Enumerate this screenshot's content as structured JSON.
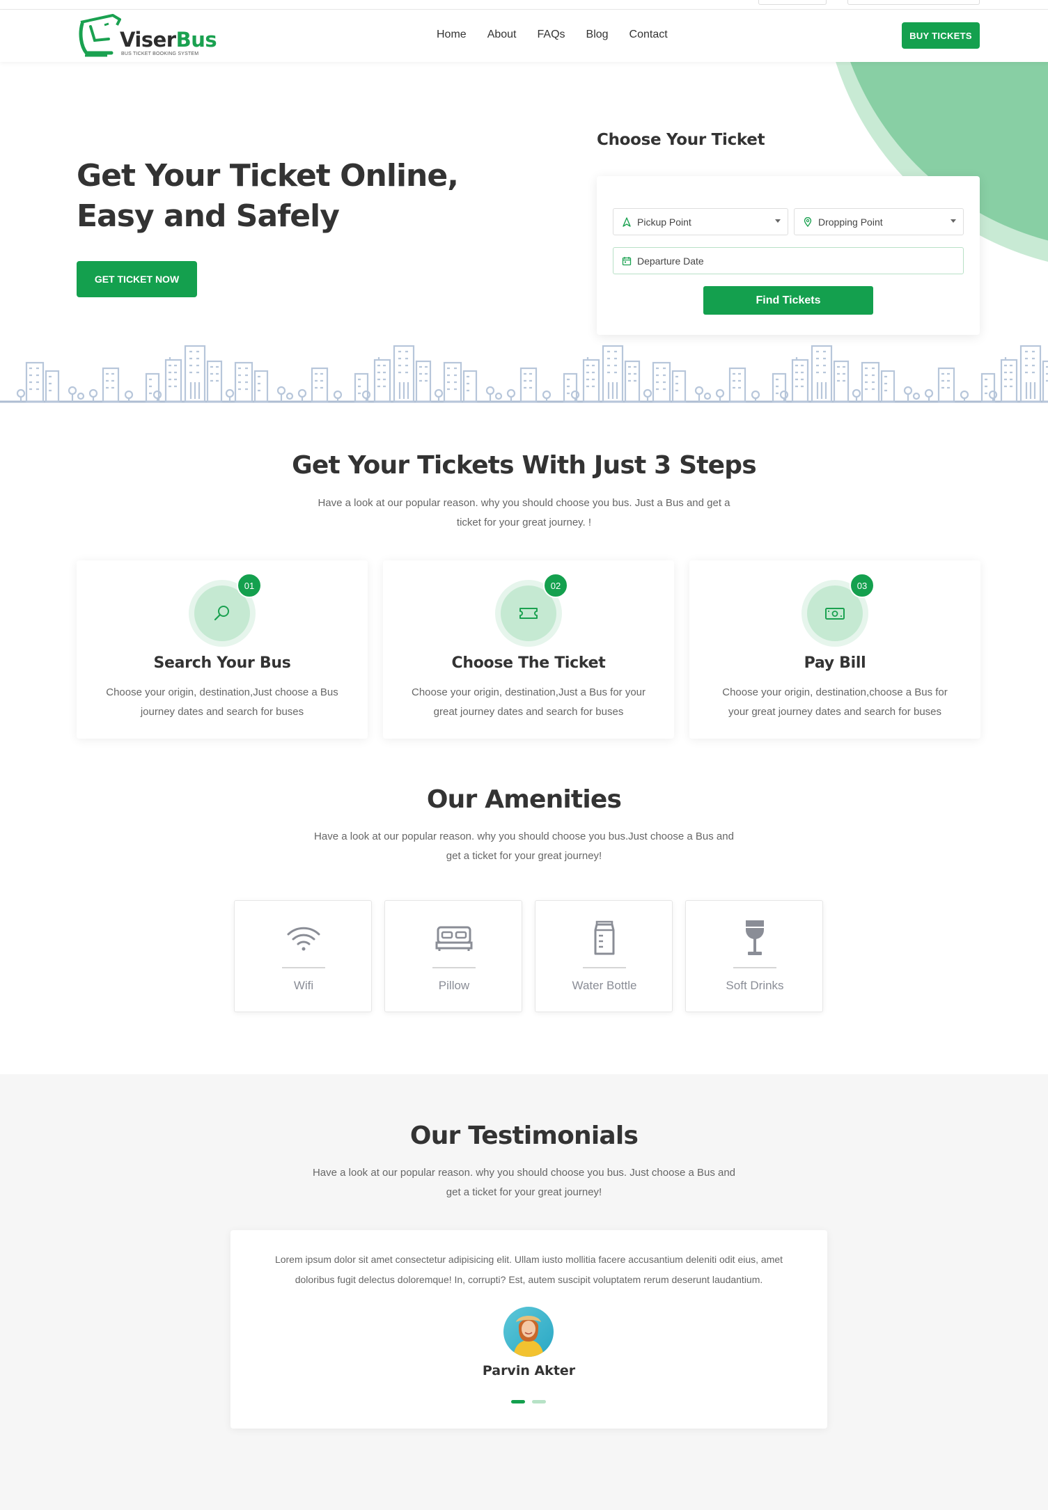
{
  "brand": {
    "name_part1": "Viser",
    "name_part2": "Bus",
    "tagline": "BUS TICKET BOOKING SYSTEM",
    "accent": "#14a04e",
    "accent_light": "#88cfa4"
  },
  "nav": {
    "items": [
      "Home",
      "About",
      "FAQs",
      "Blog",
      "Contact"
    ],
    "buy_label": "BUY TICKETS"
  },
  "hero": {
    "title_line1": "Get Your Ticket Online,",
    "title_line2": "Easy and Safely",
    "cta_label": "GET TICKET NOW"
  },
  "booking": {
    "title": "Choose Your Ticket",
    "pickup_placeholder": "Pickup Point",
    "dropping_placeholder": "Dropping Point",
    "date_placeholder": "Departure Date",
    "find_label": "Find Tickets"
  },
  "steps": {
    "title": "Get Your Tickets With Just 3 Steps",
    "sub_line1": "Have a look at our popular reason. why you should choose you bus. Just a Bus and get a",
    "sub_line2": "ticket for your great journey. !",
    "items": [
      {
        "num": "01",
        "icon": "search-icon",
        "title": "Search Your Bus",
        "desc1": "Choose your origin, destination,Just choose a Bus",
        "desc2": "journey dates and search for buses"
      },
      {
        "num": "02",
        "icon": "ticket-icon",
        "title": "Choose The Ticket",
        "desc1": "Choose your origin, destination,Just a Bus for your",
        "desc2": "great journey dates and search for buses"
      },
      {
        "num": "03",
        "icon": "money-icon",
        "title": "Pay Bill",
        "desc1": "Choose your origin, destination,choose a Bus for",
        "desc2": "your great journey dates and search for buses"
      }
    ]
  },
  "amenities": {
    "title": "Our Amenities",
    "sub_line1": "Have a look at our popular reason. why you should choose you bus.Just choose a Bus and",
    "sub_line2": "get a ticket for your great journey!",
    "items": [
      {
        "icon": "wifi-icon",
        "label": "Wifi"
      },
      {
        "icon": "bed-icon",
        "label": "Pillow"
      },
      {
        "icon": "bottle-icon",
        "label": "Water Bottle"
      },
      {
        "icon": "glass-icon",
        "label": "Soft Drinks"
      }
    ]
  },
  "testimonials": {
    "title": "Our Testimonials",
    "sub_line1": "Have a look at our popular reason. why you should choose you bus. Just choose a Bus and",
    "sub_line2": "get a ticket for your great journey!",
    "quote_line1": "Lorem ipsum dolor sit amet consectetur adipisicing elit. Ullam iusto mollitia facere accusantium deleniti odit eius, amet",
    "quote_line2": "doloribus fugit delectus doloremque! In, corrupti? Est, autem suscipit voluptatem rerum deserunt laudantium.",
    "person": "Parvin Akter"
  }
}
